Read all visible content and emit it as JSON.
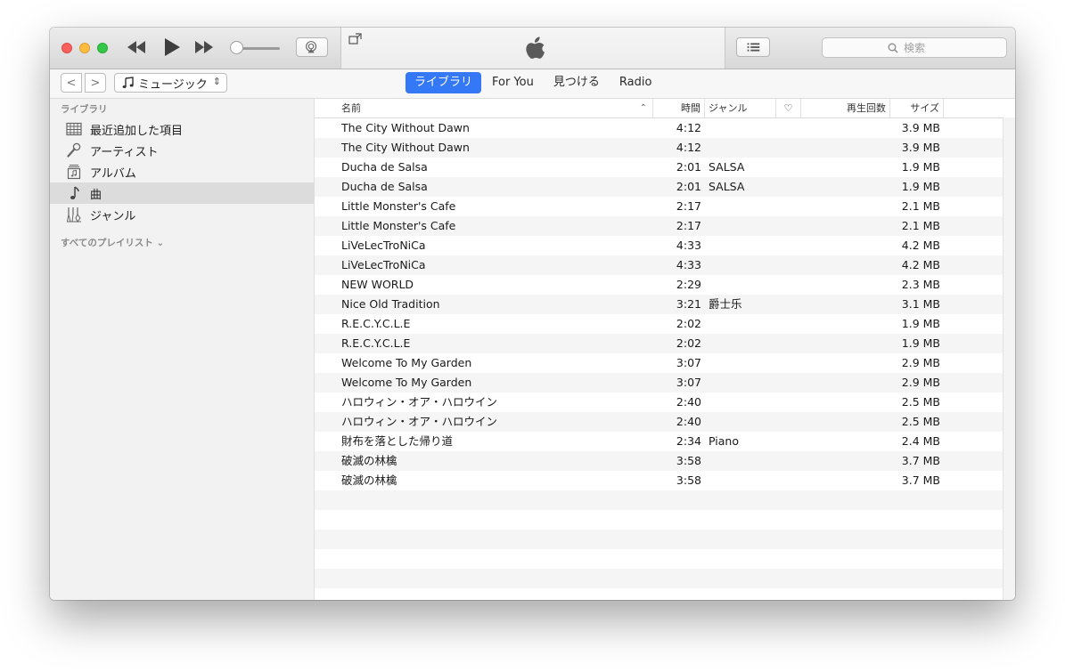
{
  "toolbar": {
    "search_placeholder": "検索"
  },
  "nav": {
    "back": "<",
    "forward": ">",
    "media_kind": "ミュージック",
    "tabs": [
      {
        "label": "ライブラリ",
        "active": true
      },
      {
        "label": "For You",
        "active": false
      },
      {
        "label": "見つける",
        "active": false
      },
      {
        "label": "Radio",
        "active": false
      }
    ]
  },
  "sidebar": {
    "header": "ライブラリ",
    "items": [
      {
        "label": "最近追加した項目",
        "icon": "grid-calendar-icon"
      },
      {
        "label": "アーティスト",
        "icon": "microphone-icon"
      },
      {
        "label": "アルバム",
        "icon": "album-icon"
      },
      {
        "label": "曲",
        "icon": "music-note-icon",
        "selected": true
      },
      {
        "label": "ジャンル",
        "icon": "genre-icon"
      }
    ],
    "playlists_header": "すべてのプレイリスト ⌄"
  },
  "table": {
    "columns": {
      "name": "名前",
      "time": "時間",
      "genre": "ジャンル",
      "love": "♡",
      "plays": "再生回数",
      "size": "サイズ"
    },
    "rows": [
      {
        "name": "The City Without Dawn",
        "time": "4:12",
        "genre": "",
        "size": "3.9 MB"
      },
      {
        "name": "The City Without Dawn",
        "time": "4:12",
        "genre": "",
        "size": "3.9 MB"
      },
      {
        "name": "Ducha de Salsa",
        "time": "2:01",
        "genre": "SALSA",
        "size": "1.9 MB"
      },
      {
        "name": "Ducha de Salsa",
        "time": "2:01",
        "genre": "SALSA",
        "size": "1.9 MB"
      },
      {
        "name": "Little Monster's Cafe",
        "time": "2:17",
        "genre": "",
        "size": "2.1 MB"
      },
      {
        "name": "Little Monster's Cafe",
        "time": "2:17",
        "genre": "",
        "size": "2.1 MB"
      },
      {
        "name": "LiVeLecTroNiCa",
        "time": "4:33",
        "genre": "",
        "size": "4.2 MB"
      },
      {
        "name": "LiVeLecTroNiCa",
        "time": "4:33",
        "genre": "",
        "size": "4.2 MB"
      },
      {
        "name": "NEW WORLD",
        "time": "2:29",
        "genre": "",
        "size": "2.3 MB"
      },
      {
        "name": "Nice Old Tradition",
        "time": "3:21",
        "genre": "爵士乐",
        "size": "3.1 MB"
      },
      {
        "name": "R.E.C.Y.C.L.E",
        "time": "2:02",
        "genre": "",
        "size": "1.9 MB"
      },
      {
        "name": "R.E.C.Y.C.L.E",
        "time": "2:02",
        "genre": "",
        "size": "1.9 MB"
      },
      {
        "name": "Welcome To My Garden",
        "time": "3:07",
        "genre": "",
        "size": "2.9 MB"
      },
      {
        "name": "Welcome To My Garden",
        "time": "3:07",
        "genre": "",
        "size": "2.9 MB"
      },
      {
        "name": "ハロウィン・オア・ハロウイン",
        "time": "2:40",
        "genre": "",
        "size": "2.5 MB"
      },
      {
        "name": "ハロウィン・オア・ハロウイン",
        "time": "2:40",
        "genre": "",
        "size": "2.5 MB"
      },
      {
        "name": "財布を落とした帰り道",
        "time": "2:34",
        "genre": "Piano",
        "size": "2.4 MB"
      },
      {
        "name": "破滅の林檎",
        "time": "3:58",
        "genre": "",
        "size": "3.7 MB"
      },
      {
        "name": "破滅の林檎",
        "time": "3:58",
        "genre": "",
        "size": "3.7 MB"
      }
    ]
  },
  "colors": {
    "accent": "#3478f6",
    "close": "#fc605c",
    "minimize": "#fdbc40",
    "zoom": "#34c84a"
  }
}
